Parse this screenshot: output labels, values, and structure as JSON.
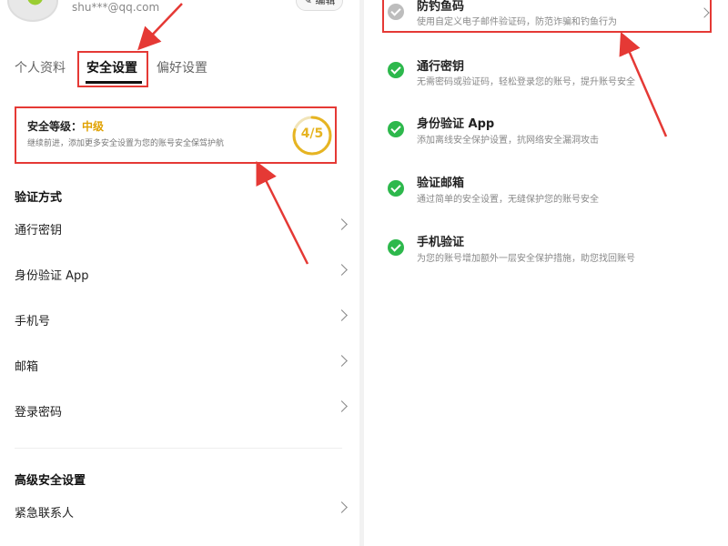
{
  "profile": {
    "email": "shu***@qq.com",
    "edit_label": "编辑"
  },
  "tabs": [
    {
      "label": "个人资料"
    },
    {
      "label": "安全设置"
    },
    {
      "label": "偏好设置"
    }
  ],
  "security": {
    "title_prefix": "安全等级：",
    "level": "中级",
    "desc": "继续前进，添加更多安全设置为您的账号安全保驾护航",
    "score": "4/5",
    "progress_fraction": 0.8
  },
  "verification": {
    "section_title": "验证方式",
    "items": [
      {
        "label": "通行密钥"
      },
      {
        "label": "身份验证 App"
      },
      {
        "label": "手机号"
      },
      {
        "label": "邮箱"
      },
      {
        "label": "登录密码"
      }
    ]
  },
  "advanced": {
    "section_title": "高级安全设置",
    "items": [
      {
        "label": "紧急联系人"
      }
    ]
  },
  "right_panel": {
    "items": [
      {
        "title": "防钓鱼码",
        "desc": "使用自定义电子邮件验证码，防范诈骗和钓鱼行为",
        "status": "pending"
      },
      {
        "title": "通行密钥",
        "desc": "无需密码或验证码，轻松登录您的账号，提升账号安全",
        "status": "done"
      },
      {
        "title": "身份验证 App",
        "desc": "添加离线安全保护设置，抗网络安全漏洞攻击",
        "status": "done"
      },
      {
        "title": "验证邮箱",
        "desc": "通过简单的安全设置，无缝保护您的账号安全",
        "status": "done"
      },
      {
        "title": "手机验证",
        "desc": "为您的账号增加额外一层安全保护措施，助您找回账号",
        "status": "done"
      }
    ]
  },
  "colors": {
    "accent_gold": "#e6b422",
    "success_green": "#2db84c",
    "annotation_red": "#e53935"
  }
}
